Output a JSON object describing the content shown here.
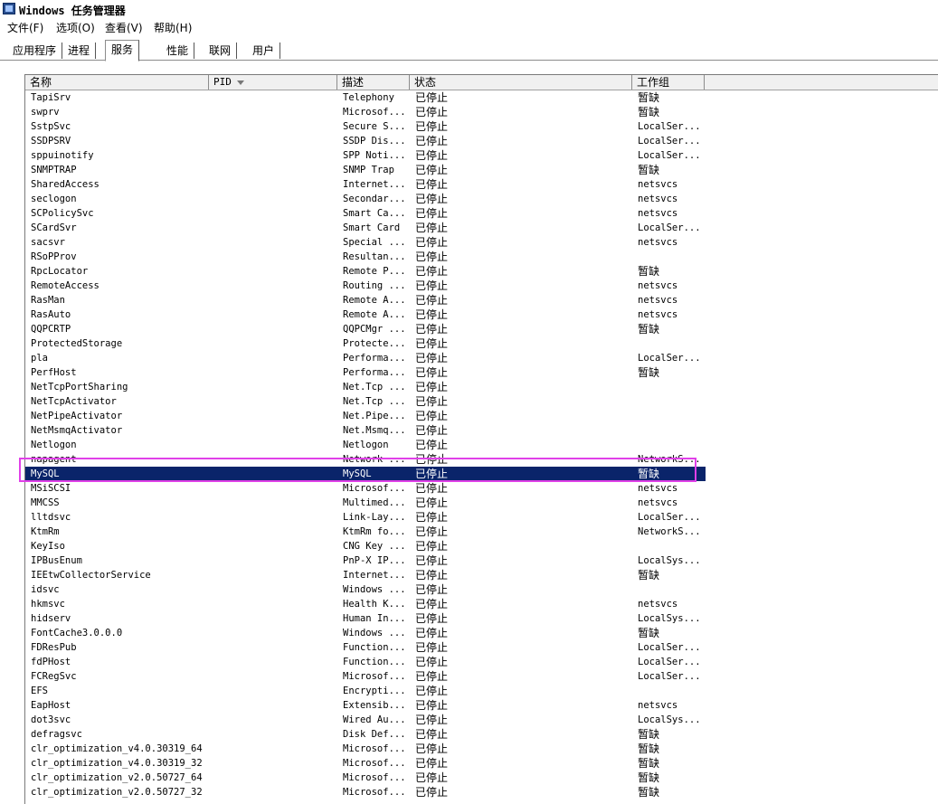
{
  "window": {
    "title": "Windows 任务管理器"
  },
  "menu": [
    {
      "label": "文件(F)"
    },
    {
      "label": "选项(O)"
    },
    {
      "label": "查看(V)"
    },
    {
      "label": "帮助(H)"
    }
  ],
  "tabs": [
    {
      "label": "应用程序",
      "active": false
    },
    {
      "label": "进程",
      "active": false
    },
    {
      "label": "服务",
      "active": true
    },
    {
      "label": "性能",
      "active": false
    },
    {
      "label": "联网",
      "active": false
    },
    {
      "label": "用户",
      "active": false
    }
  ],
  "columns": [
    {
      "label": "名称"
    },
    {
      "label": "PID",
      "sorted": true
    },
    {
      "label": "描述"
    },
    {
      "label": "状态"
    },
    {
      "label": "工作组"
    }
  ],
  "selected_row": 26,
  "colors": {
    "selection": "#0a246a",
    "highlight_box": "#e040e8"
  },
  "services": [
    {
      "name": "TapiSrv",
      "desc": "Telephony",
      "status": "已停止",
      "group": "暂缺"
    },
    {
      "name": "swprv",
      "desc": "Microsof...",
      "status": "已停止",
      "group": "暂缺"
    },
    {
      "name": "SstpSvc",
      "desc": "Secure S...",
      "status": "已停止",
      "group": "LocalSer..."
    },
    {
      "name": "SSDPSRV",
      "desc": "SSDP Dis...",
      "status": "已停止",
      "group": "LocalSer..."
    },
    {
      "name": "sppuinotify",
      "desc": "SPP Noti...",
      "status": "已停止",
      "group": "LocalSer..."
    },
    {
      "name": "SNMPTRAP",
      "desc": "SNMP Trap",
      "status": "已停止",
      "group": "暂缺"
    },
    {
      "name": "SharedAccess",
      "desc": "Internet...",
      "status": "已停止",
      "group": "netsvcs"
    },
    {
      "name": "seclogon",
      "desc": "Secondar...",
      "status": "已停止",
      "group": "netsvcs"
    },
    {
      "name": "SCPolicySvc",
      "desc": "Smart Ca...",
      "status": "已停止",
      "group": "netsvcs"
    },
    {
      "name": "SCardSvr",
      "desc": "Smart Card",
      "status": "已停止",
      "group": "LocalSer..."
    },
    {
      "name": "sacsvr",
      "desc": "Special ...",
      "status": "已停止",
      "group": "netsvcs"
    },
    {
      "name": "RSoPProv",
      "desc": "Resultan...",
      "status": "已停止",
      "group": ""
    },
    {
      "name": "RpcLocator",
      "desc": "Remote P...",
      "status": "已停止",
      "group": "暂缺"
    },
    {
      "name": "RemoteAccess",
      "desc": "Routing ...",
      "status": "已停止",
      "group": "netsvcs"
    },
    {
      "name": "RasMan",
      "desc": "Remote A...",
      "status": "已停止",
      "group": "netsvcs"
    },
    {
      "name": "RasAuto",
      "desc": "Remote A...",
      "status": "已停止",
      "group": "netsvcs"
    },
    {
      "name": "QQPCRTP",
      "desc": "QQPCMgr ...",
      "status": "已停止",
      "group": "暂缺"
    },
    {
      "name": "ProtectedStorage",
      "desc": "Protecte...",
      "status": "已停止",
      "group": ""
    },
    {
      "name": "pla",
      "desc": "Performa...",
      "status": "已停止",
      "group": "LocalSer..."
    },
    {
      "name": "PerfHost",
      "desc": "Performa...",
      "status": "已停止",
      "group": "暂缺"
    },
    {
      "name": "NetTcpPortSharing",
      "desc": "Net.Tcp ...",
      "status": "已停止",
      "group": ""
    },
    {
      "name": "NetTcpActivator",
      "desc": "Net.Tcp ...",
      "status": "已停止",
      "group": ""
    },
    {
      "name": "NetPipeActivator",
      "desc": "Net.Pipe...",
      "status": "已停止",
      "group": ""
    },
    {
      "name": "NetMsmqActivator",
      "desc": "Net.Msmq...",
      "status": "已停止",
      "group": ""
    },
    {
      "name": "Netlogon",
      "desc": "Netlogon",
      "status": "已停止",
      "group": ""
    },
    {
      "name": "napagent",
      "desc": "Network ...",
      "status": "已停止",
      "group": "NetworkS..."
    },
    {
      "name": "MySQL",
      "desc": "MySQL",
      "status": "已停止",
      "group": "暂缺"
    },
    {
      "name": "MSiSCSI",
      "desc": "Microsof...",
      "status": "已停止",
      "group": "netsvcs"
    },
    {
      "name": "MMCSS",
      "desc": "Multimed...",
      "status": "已停止",
      "group": "netsvcs"
    },
    {
      "name": "lltdsvc",
      "desc": "Link-Lay...",
      "status": "已停止",
      "group": "LocalSer..."
    },
    {
      "name": "KtmRm",
      "desc": "KtmRm fo...",
      "status": "已停止",
      "group": "NetworkS..."
    },
    {
      "name": "KeyIso",
      "desc": "CNG Key ...",
      "status": "已停止",
      "group": ""
    },
    {
      "name": "IPBusEnum",
      "desc": "PnP-X IP...",
      "status": "已停止",
      "group": "LocalSys..."
    },
    {
      "name": "IEEtwCollectorService",
      "desc": "Internet...",
      "status": "已停止",
      "group": "暂缺"
    },
    {
      "name": "idsvc",
      "desc": "Windows ...",
      "status": "已停止",
      "group": ""
    },
    {
      "name": "hkmsvc",
      "desc": "Health K...",
      "status": "已停止",
      "group": "netsvcs"
    },
    {
      "name": "hidserv",
      "desc": "Human In...",
      "status": "已停止",
      "group": "LocalSys..."
    },
    {
      "name": "FontCache3.0.0.0",
      "desc": "Windows ...",
      "status": "已停止",
      "group": "暂缺"
    },
    {
      "name": "FDResPub",
      "desc": "Function...",
      "status": "已停止",
      "group": "LocalSer..."
    },
    {
      "name": "fdPHost",
      "desc": "Function...",
      "status": "已停止",
      "group": "LocalSer..."
    },
    {
      "name": "FCRegSvc",
      "desc": "Microsof...",
      "status": "已停止",
      "group": "LocalSer..."
    },
    {
      "name": "EFS",
      "desc": "Encrypti...",
      "status": "已停止",
      "group": ""
    },
    {
      "name": "EapHost",
      "desc": "Extensib...",
      "status": "已停止",
      "group": "netsvcs"
    },
    {
      "name": "dot3svc",
      "desc": "Wired Au...",
      "status": "已停止",
      "group": "LocalSys..."
    },
    {
      "name": "defragsvc",
      "desc": "Disk Def...",
      "status": "已停止",
      "group": "暂缺"
    },
    {
      "name": "clr_optimization_v4.0.30319_64",
      "desc": "Microsof...",
      "status": "已停止",
      "group": "暂缺"
    },
    {
      "name": "clr_optimization_v4.0.30319_32",
      "desc": "Microsof...",
      "status": "已停止",
      "group": "暂缺"
    },
    {
      "name": "clr_optimization_v2.0.50727_64",
      "desc": "Microsof...",
      "status": "已停止",
      "group": "暂缺"
    },
    {
      "name": "clr_optimization_v2.0.50727_32",
      "desc": "Microsof...",
      "status": "已停止",
      "group": "暂缺"
    }
  ]
}
